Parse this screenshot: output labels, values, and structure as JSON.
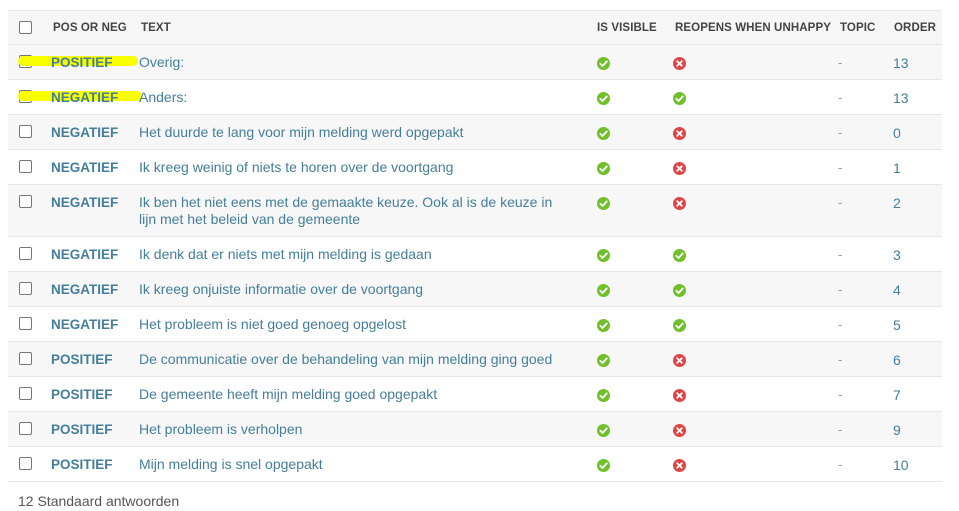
{
  "columns": {
    "pos_or_neg": "POS OR NEG",
    "text": "TEXT",
    "is_visible": "IS VISIBLE",
    "reopens": "REOPENS WHEN UNHAPPY",
    "topic": "TOPIC",
    "order": "ORDER"
  },
  "rows": [
    {
      "pos": "POSITIEF",
      "text": "Overig:",
      "visible": true,
      "reopens": false,
      "topic": "-",
      "order": "13",
      "highlighted": true
    },
    {
      "pos": "NEGATIEF",
      "text": "Anders:",
      "visible": true,
      "reopens": true,
      "topic": "-",
      "order": "13",
      "highlighted": true
    },
    {
      "pos": "NEGATIEF",
      "text": "Het duurde te lang voor mijn melding werd opgepakt",
      "visible": true,
      "reopens": false,
      "topic": "-",
      "order": "0"
    },
    {
      "pos": "NEGATIEF",
      "text": "Ik kreeg weinig of niets te horen over de voortgang",
      "visible": true,
      "reopens": false,
      "topic": "-",
      "order": "1"
    },
    {
      "pos": "NEGATIEF",
      "text": "Ik ben het niet eens met de gemaakte keuze. Ook al is de keuze in lijn met het beleid van de gemeente",
      "visible": true,
      "reopens": false,
      "topic": "-",
      "order": "2"
    },
    {
      "pos": "NEGATIEF",
      "text": "Ik denk dat er niets met mijn melding is gedaan",
      "visible": true,
      "reopens": true,
      "topic": "-",
      "order": "3"
    },
    {
      "pos": "NEGATIEF",
      "text": "Ik kreeg onjuiste informatie over de voortgang",
      "visible": true,
      "reopens": true,
      "topic": "-",
      "order": "4"
    },
    {
      "pos": "NEGATIEF",
      "text": "Het probleem is niet goed genoeg opgelost",
      "visible": true,
      "reopens": true,
      "topic": "-",
      "order": "5"
    },
    {
      "pos": "POSITIEF",
      "text": "De communicatie over de behandeling van mijn melding ging goed",
      "visible": true,
      "reopens": false,
      "topic": "-",
      "order": "6"
    },
    {
      "pos": "POSITIEF",
      "text": "De gemeente heeft mijn melding goed opgepakt",
      "visible": true,
      "reopens": false,
      "topic": "-",
      "order": "7"
    },
    {
      "pos": "POSITIEF",
      "text": "Het probleem is verholpen",
      "visible": true,
      "reopens": false,
      "topic": "-",
      "order": "9"
    },
    {
      "pos": "POSITIEF",
      "text": "Mijn melding is snel opgepakt",
      "visible": true,
      "reopens": false,
      "topic": "-",
      "order": "10"
    }
  ],
  "footer": "12 Standaard antwoorden",
  "icons": {
    "yes": "check-circle-icon",
    "no": "x-circle-icon"
  },
  "colors": {
    "link": "#447e9b",
    "yes": "#70bf2b",
    "no": "#dd4646",
    "highlight": "#f7ff00"
  }
}
